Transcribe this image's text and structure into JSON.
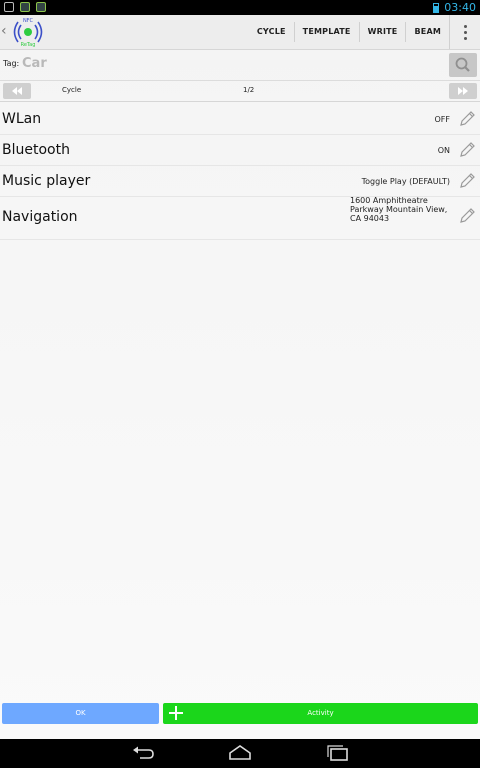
{
  "status_bar": {
    "time": "03:40"
  },
  "app": {
    "logo_text_top": "NFC",
    "logo_text_bottom": "ReTag"
  },
  "action_bar": {
    "actions": [
      "CYCLE",
      "TEMPLATE",
      "WRITE",
      "BEAM"
    ]
  },
  "tag": {
    "label": "Tag:",
    "value": "Car"
  },
  "pager": {
    "name": "Cycle",
    "count": "1/2"
  },
  "items": [
    {
      "label": "WLan",
      "value": "OFF"
    },
    {
      "label": "Bluetooth",
      "value": "ON"
    },
    {
      "label": "Music player",
      "value": "Toggle Play (DEFAULT)"
    },
    {
      "label": "Navigation",
      "value": "1600 Amphitheatre Parkway Mountain View, CA 94043"
    }
  ],
  "buttons": {
    "ok": "OK",
    "activity": "Activity"
  },
  "colors": {
    "accent": "#33b5e5",
    "ok_button": "#6ea8ff",
    "activity_button": "#1bd61b"
  }
}
